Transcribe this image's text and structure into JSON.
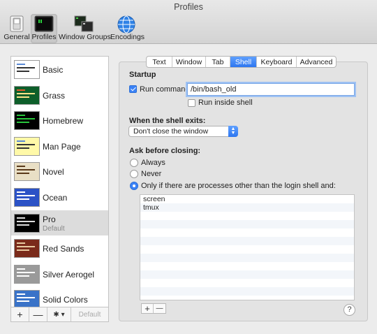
{
  "window": {
    "title": "Profiles"
  },
  "toolbar": [
    {
      "label": "General",
      "icon": "general-switch-icon"
    },
    {
      "label": "Profiles",
      "icon": "terminal-profile-icon",
      "selected": true
    },
    {
      "label": "Window Groups",
      "icon": "window-groups-icon"
    },
    {
      "label": "Encodings",
      "icon": "globe-icon"
    }
  ],
  "profiles": [
    {
      "name": "Basic",
      "bg": "#ffffff",
      "fg": "#333333",
      "hl": "#5a8ad6"
    },
    {
      "name": "Grass",
      "bg": "#0d5e2a",
      "fg": "#ffe38a",
      "hl": "#e55b2b"
    },
    {
      "name": "Homebrew",
      "bg": "#000000",
      "fg": "#29c63c",
      "hl": "#29c63c"
    },
    {
      "name": "Man Page",
      "bg": "#fff9a8",
      "fg": "#333333",
      "hl": "#5a8ad6"
    },
    {
      "name": "Novel",
      "bg": "#e9dfc5",
      "fg": "#5b3a1a",
      "hl": "#5b3a1a"
    },
    {
      "name": "Ocean",
      "bg": "#2b52c6",
      "fg": "#ffffff",
      "hl": "#ffffff"
    },
    {
      "name": "Pro",
      "sub": "Default",
      "bg": "#000000",
      "fg": "#dddddd",
      "hl": "#dddddd",
      "selected": true
    },
    {
      "name": "Red Sands",
      "bg": "#7a2a1a",
      "fg": "#e8c9a0",
      "hl": "#e8c9a0"
    },
    {
      "name": "Silver Aerogel",
      "bg": "#9a9a9a",
      "fg": "#ffffff",
      "hl": "#ffffff"
    },
    {
      "name": "Solid Colors",
      "bg": "#3a73c8",
      "fg": "#ffffff",
      "hl": "#ffffff"
    }
  ],
  "sidebar_bottom": {
    "add": "+",
    "remove": "—",
    "gear": "✱ ▾",
    "default": "Default"
  },
  "tabs": [
    {
      "label": "Text"
    },
    {
      "label": "Window"
    },
    {
      "label": "Tab"
    },
    {
      "label": "Shell",
      "active": true
    },
    {
      "label": "Keyboard"
    },
    {
      "label": "Advanced"
    }
  ],
  "startup": {
    "heading": "Startup",
    "run_command_label": "Run command:",
    "run_command_checked": true,
    "command_value": "/bin/bash_old",
    "run_inside_shell_label": "Run inside shell",
    "run_inside_shell_checked": false
  },
  "shell_exit": {
    "heading": "When the shell exits:",
    "selected": "Don't close the window"
  },
  "ask_before_closing": {
    "heading": "Ask before closing:",
    "options": [
      "Always",
      "Never",
      "Only if there are processes other than the login shell and:"
    ],
    "selected_index": 2,
    "processes": [
      "screen",
      "tmux"
    ]
  },
  "list_buttons": {
    "add": "+",
    "remove": "—"
  },
  "help": "?",
  "colors": {
    "accent": "#2d76f0"
  }
}
